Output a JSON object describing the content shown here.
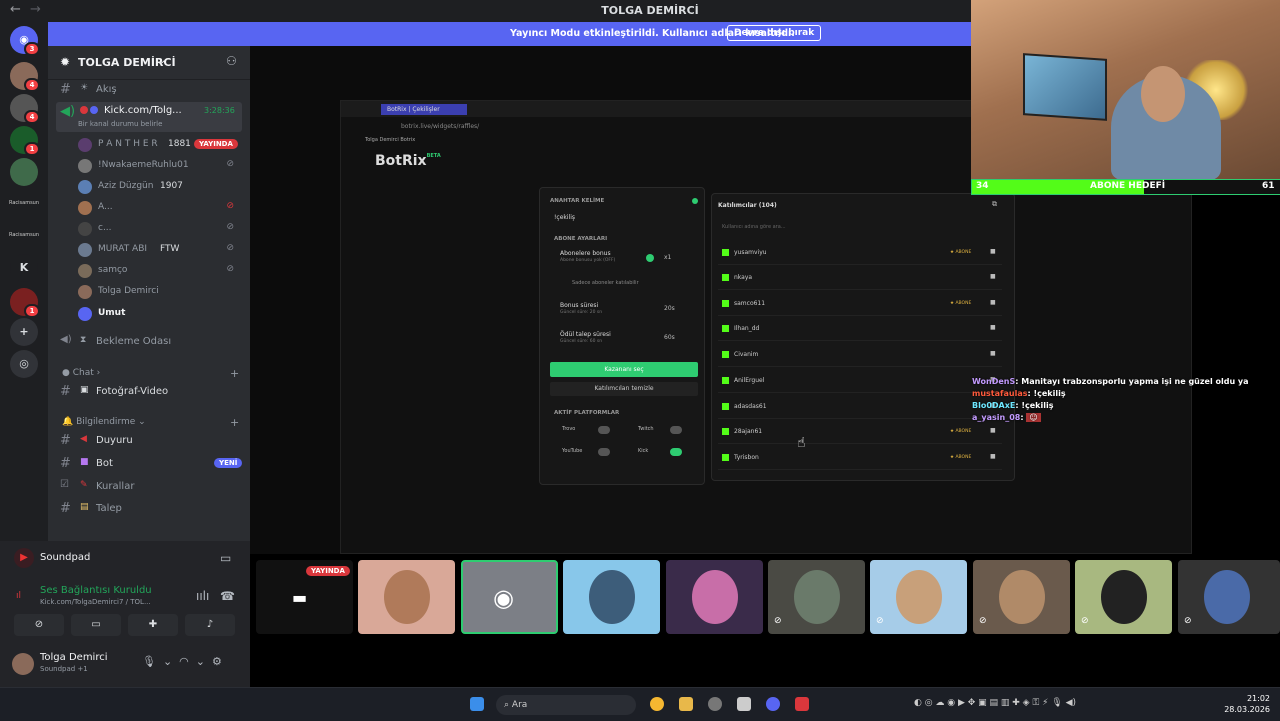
{
  "titlebar": {
    "title": "TOLGA DEMİRCİ",
    "back": "←",
    "forward": "→"
  },
  "banner": {
    "message": "Yayıncı Modu etkinleştirildi. Kullanıcı adları kısaltıldı.",
    "button": "Devre dışı bırak"
  },
  "rail": {
    "server_labels": [
      "Racisamsun",
      "Racisamsun"
    ],
    "letter": "K",
    "badges": [
      "3",
      "4",
      "4",
      "1",
      "1"
    ]
  },
  "server": {
    "name": "TOLGA DEMİRCİ",
    "chevron": "⌄"
  },
  "channels": {
    "akis": "Akış",
    "voice_title": "Kick.com/Tolg...",
    "voice_timer": "3:28:36",
    "voice_status": "Bir kanal durumu belirle",
    "users": [
      {
        "name": "P A N T H E R",
        "extra": "1881"
      },
      {
        "name": "!NwakaemeRuhlu01",
        "extra": ""
      },
      {
        "name": "Aziz Düzgün",
        "extra": "1907"
      },
      {
        "name": "A...",
        "extra": ""
      },
      {
        "name": "c...",
        "extra": ""
      },
      {
        "name": "MURAT ABI",
        "extra": "FTW"
      },
      {
        "name": "samço",
        "extra": ""
      },
      {
        "name": "Tolga Demirci",
        "extra": ""
      },
      {
        "name": "Umut",
        "extra": ""
      }
    ],
    "live_badge": "YAYINDA",
    "waiting": "Bekleme Odası",
    "chat_category": "Chat",
    "photo_video": "Fotoğraf-Video",
    "info_category": "Bilgilendirme",
    "duyuru": "Duyuru",
    "bot": "Bot",
    "new_badge": "YENİ",
    "kurallar": "Kurallar",
    "talep": "Talep"
  },
  "panel": {
    "soundpad": "Soundpad",
    "connected": "Ses Bağlantısı Kuruldu",
    "connected_sub": "Kick.com/TolgaDemirci7 / TOL...",
    "user_name": "Tolga Demirci",
    "user_status": "Soundpad +1"
  },
  "botrix": {
    "tab_title": "BotRix | Çekilişler",
    "url": "botrix.live/widgets/raffles/",
    "bookmarks": "Tolga Demirci    Botrix",
    "logo": "BotRix",
    "logo_sup": "BETA",
    "keyword_label": "ANAHTAR KELİME",
    "keyword_value": "!çekiliş",
    "sub_settings": "ABONE AYARLARI",
    "sub_bonus": "Abonelere bonus",
    "sub_bonus_sub": "Abone bonusu yok (OFF)",
    "multiplier": "x1",
    "only_subs": "Sadece aboneler katılabilir",
    "bonus_time": "Bonus süresi",
    "bonus_time_sub": "Güncel süre: 20 sn",
    "bonus_time_val": "20s",
    "claim_time": "Ödül talep süresi",
    "claim_time_sub": "Güncel süre: 60 sn",
    "claim_time_val": "60s",
    "pick_winner": "Kazananı seç",
    "clear": "Katılımcıları temizle",
    "platforms": "AKTİF PLATFORMLAR",
    "platform_names": [
      "Trovo",
      "Twitch",
      "YouTube",
      "Kick"
    ],
    "participants_title": "Katılımcılar (104)",
    "search_placeholder": "Kullanıcı adına göre ara...",
    "sub_tag": "★ ABONE",
    "participants": [
      {
        "name": "yusamviyu",
        "sub": true
      },
      {
        "name": "nkaya",
        "sub": false
      },
      {
        "name": "samco611",
        "sub": true
      },
      {
        "name": "Ilhan_dd",
        "sub": false
      },
      {
        "name": "Civanim",
        "sub": false
      },
      {
        "name": "AnilErguel",
        "sub": false
      },
      {
        "name": "adasdas61",
        "sub": false
      },
      {
        "name": "28ajan61",
        "sub": true
      },
      {
        "name": "Tyrisbon",
        "sub": true
      }
    ]
  },
  "chat": [
    {
      "user": "WonDenS",
      "color": "#c39bff",
      "text": ": Manitayı trabzonsporlu yapma işi ne güzel oldu ya"
    },
    {
      "user": "mustafaulas",
      "color": "#ff5a3c",
      "text": ": !çekiliş"
    },
    {
      "user": "Blo0DAxE",
      "color": "#6ee7ff",
      "text": ": !çekiliş"
    },
    {
      "user": "a_yasin_08",
      "color": "#c39bff",
      "text": ":"
    }
  ],
  "goal": {
    "left": "34",
    "label": "ABONE HEDEFİ",
    "right": "61",
    "progress": 0.557
  },
  "tiles": {
    "live": "YAYINDA"
  },
  "taskbar": {
    "search": "Ara",
    "time": "21:02",
    "date": "28.03.2026"
  },
  "colors": {
    "accent": "#5865f2",
    "live": "#da373c",
    "kick": "#53fc18",
    "online": "#23a55a"
  }
}
